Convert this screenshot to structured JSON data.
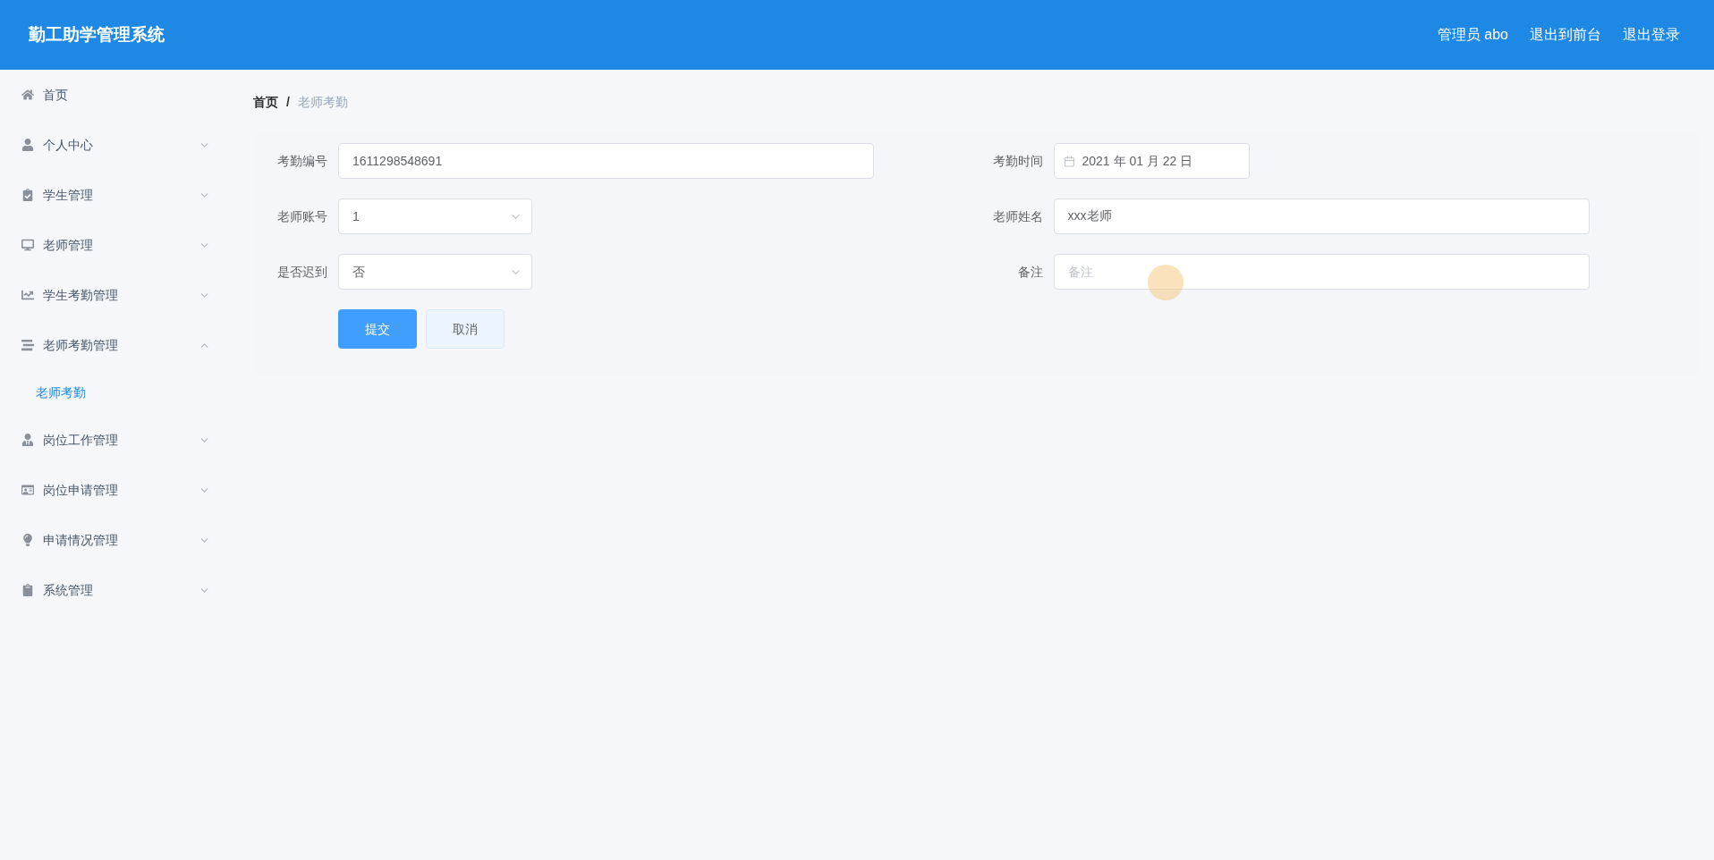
{
  "header": {
    "title": "勤工助学管理系统",
    "links": [
      "管理员 abo",
      "退出到前台",
      "退出登录"
    ]
  },
  "sidebar": {
    "items": [
      {
        "label": "首页",
        "expandable": false
      },
      {
        "label": "个人中心",
        "expandable": true,
        "expanded": false
      },
      {
        "label": "学生管理",
        "expandable": true,
        "expanded": false
      },
      {
        "label": "老师管理",
        "expandable": true,
        "expanded": false
      },
      {
        "label": "学生考勤管理",
        "expandable": true,
        "expanded": false
      },
      {
        "label": "老师考勤管理",
        "expandable": true,
        "expanded": true,
        "children": [
          {
            "label": "老师考勤",
            "selected": true
          }
        ]
      },
      {
        "label": "岗位工作管理",
        "expandable": true,
        "expanded": false
      },
      {
        "label": "岗位申请管理",
        "expandable": true,
        "expanded": false
      },
      {
        "label": "申请情况管理",
        "expandable": true,
        "expanded": false
      },
      {
        "label": "系统管理",
        "expandable": true,
        "expanded": false
      }
    ]
  },
  "breadcrumb": {
    "separator": "/",
    "items": [
      "首页",
      "老师考勤"
    ]
  },
  "form": {
    "rows": [
      [
        {
          "label": "考勤编号",
          "kind": "input",
          "value": "1611298548691"
        },
        {
          "label": "考勤时间",
          "kind": "date",
          "value": "2021 年 01 月 22 日"
        }
      ],
      [
        {
          "label": "老师账号",
          "kind": "select",
          "value": "1"
        },
        {
          "label": "老师姓名",
          "kind": "input",
          "value": "xxx老师"
        }
      ],
      [
        {
          "label": "是否迟到",
          "kind": "select",
          "value": "否"
        },
        {
          "label": "备注",
          "kind": "input",
          "placeholder": "备注"
        }
      ]
    ],
    "buttons": [
      {
        "label": "提交",
        "kind": "primary"
      },
      {
        "label": "取消",
        "kind": "default"
      }
    ]
  }
}
